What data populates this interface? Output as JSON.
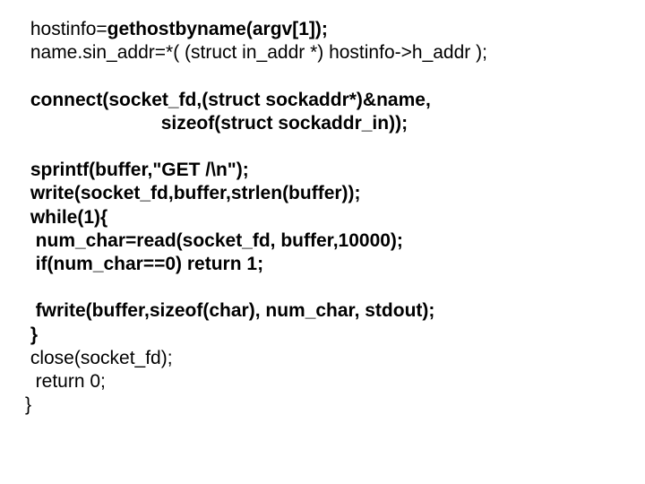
{
  "lines": [
    {
      "segments": [
        {
          "text": " hostinfo=",
          "bold": false
        },
        {
          "text": "gethostbyname(argv[1]);",
          "bold": true
        }
      ]
    },
    {
      "segments": [
        {
          "text": " name.sin_addr=*( (struct in_addr *) hostinfo->h_addr );",
          "bold": false
        }
      ]
    },
    {
      "blank": true
    },
    {
      "segments": [
        {
          "text": " connect(socket_fd,(struct sockaddr*)&name,",
          "bold": true
        }
      ]
    },
    {
      "segments": [
        {
          "text": "                          sizeof(struct sockaddr_in));",
          "bold": true
        }
      ]
    },
    {
      "blank": true
    },
    {
      "segments": [
        {
          "text": " sprintf(buffer,\"GET /\\n\");",
          "bold": true
        }
      ]
    },
    {
      "segments": [
        {
          "text": " write(socket_fd,buffer,strlen(buffer));",
          "bold": true
        }
      ]
    },
    {
      "segments": [
        {
          "text": " while(1){",
          "bold": true
        }
      ]
    },
    {
      "segments": [
        {
          "text": "  num_char=read(socket_fd, buffer,10000);",
          "bold": true
        }
      ]
    },
    {
      "segments": [
        {
          "text": "  if(num_char==0) return 1;",
          "bold": true
        }
      ]
    },
    {
      "blank": true
    },
    {
      "segments": [
        {
          "text": "  fwrite(buffer,sizeof(char), num_char, stdout);",
          "bold": true
        }
      ]
    },
    {
      "segments": [
        {
          "text": " }",
          "bold": true
        }
      ]
    },
    {
      "segments": [
        {
          "text": " close(socket_fd);",
          "bold": false
        }
      ]
    },
    {
      "segments": [
        {
          "text": "  return 0;",
          "bold": false
        }
      ]
    },
    {
      "segments": [
        {
          "text": "}",
          "bold": false
        }
      ]
    }
  ]
}
